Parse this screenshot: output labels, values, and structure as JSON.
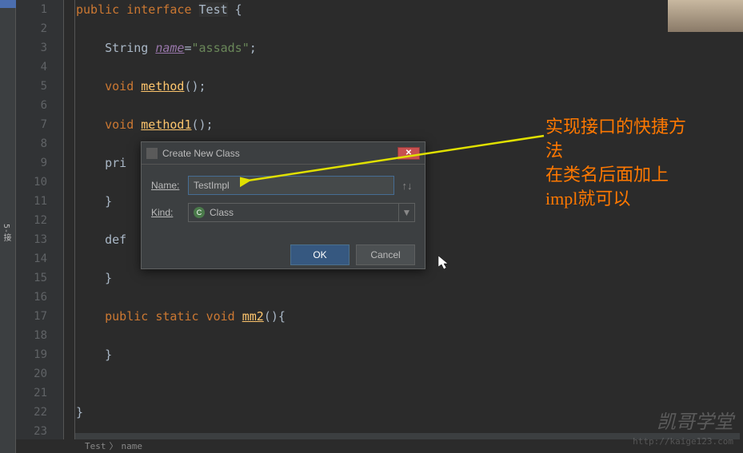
{
  "left_panel": {
    "tag": "5-接"
  },
  "gutter": {
    "lines": [
      "1",
      "2",
      "3",
      "4",
      "5",
      "6",
      "7",
      "8",
      "9",
      "10",
      "11",
      "12",
      "13",
      "14",
      "15",
      "16",
      "17",
      "18",
      "19",
      "20",
      "21",
      "22",
      "23"
    ]
  },
  "code": {
    "l1": {
      "kw1": "public",
      "kw2": "interface",
      "name": "Test",
      "brace": " {"
    },
    "l3": {
      "type": "String ",
      "field": "name",
      "eq": "=",
      "str": "\"assads\"",
      "semi": ";"
    },
    "l5": {
      "kw": "void ",
      "m": "method",
      "rest": "();"
    },
    "l7": {
      "kw": "void ",
      "m": "method1",
      "rest": "();"
    },
    "l9": {
      "txt": "pri"
    },
    "l11": {
      "txt": "}"
    },
    "l13": {
      "txt": "def"
    },
    "l15": {
      "txt": "}"
    },
    "l17": {
      "kw1": "public",
      "kw2": "static",
      "kw3": "void",
      "m": "mm2",
      "rest": "(){"
    },
    "l19": {
      "txt": "}"
    },
    "l22": {
      "txt": "}"
    }
  },
  "dialog": {
    "title": "Create New Class",
    "name_label": "Name:",
    "name_value": "TestImpl",
    "sort_glyph": "↑↓",
    "kind_label": "Kind:",
    "kind_icon": "C",
    "kind_value": "Class",
    "kind_arrow": "▼",
    "ok": "OK",
    "cancel": "Cancel",
    "close": "✕"
  },
  "annotation": {
    "l1": "实现接口的快捷方",
    "l2": "法",
    "l3": "在类名后面加上",
    "l4": "impl就可以"
  },
  "watermark": {
    "text": "凯哥学堂",
    "url": "http://kaige123.com"
  },
  "breadcrumb": {
    "p1": "Test",
    "sep": "〉",
    "p2": "name"
  }
}
